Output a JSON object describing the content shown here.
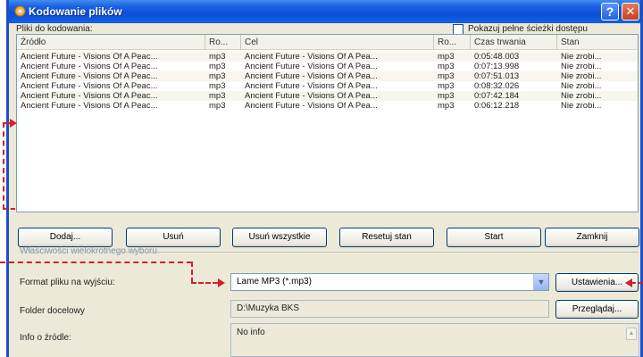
{
  "window": {
    "title": "Kodowanie plików",
    "help_glyph": "?",
    "close_glyph": "✕"
  },
  "files_label": "Pliki do kodowania:",
  "show_full_paths": {
    "label": "Pokazuj pełne ścieżki dostępu",
    "checked": false
  },
  "table": {
    "columns": [
      "Źródło",
      "Ro...",
      "Cel",
      "Ro...",
      "Czas trwania",
      "Stan"
    ],
    "rows": [
      [
        "Ancient Future - Visions Of A Peac...",
        "mp3",
        "Ancient Future - Visions Of A Pea...",
        "mp3",
        "0:05:48.003",
        "Nie zrobi..."
      ],
      [
        "Ancient Future - Visions Of A Peac...",
        "mp3",
        "Ancient Future - Visions Of A Pea...",
        "mp3",
        "0:07:13.998",
        "Nie zrobi..."
      ],
      [
        "Ancient Future - Visions Of A Peac...",
        "mp3",
        "Ancient Future - Visions Of A Pea...",
        "mp3",
        "0:07:51.013",
        "Nie zrobi..."
      ],
      [
        "Ancient Future - Visions Of A Peac...",
        "mp3",
        "Ancient Future - Visions Of A Pea...",
        "mp3",
        "0:08:32.026",
        "Nie zrobi..."
      ],
      [
        "Ancient Future - Visions Of A Peac...",
        "mp3",
        "Ancient Future - Visions Of A Pea...",
        "mp3",
        "0:07:42.184",
        "Nie zrobi..."
      ],
      [
        "Ancient Future - Visions Of A Peac...",
        "mp3",
        "Ancient Future - Visions Of A Pea...",
        "mp3",
        "0:06:12.218",
        "Nie zrobi..."
      ]
    ]
  },
  "buttons": {
    "add": "Dodaj...",
    "remove": "Usuń",
    "remove_all": "Usuń wszystkie",
    "reset": "Resetuj stan",
    "start": "Start",
    "close": "Zamknij"
  },
  "group_title": "Właściwości wielokrotnego wyboru",
  "output_format": {
    "label": "Format pliku na wyjściu:",
    "value": "Lame MP3 (*.mp3)",
    "settings_button": "Ustawienia..."
  },
  "dest_folder": {
    "label": "Folder docelowy",
    "value": "D:\\Muzyka BKS",
    "browse_button": "Przeglądaj..."
  },
  "source_info": {
    "label": "Info o źródle:",
    "value": "No info"
  },
  "icons": {
    "app": "app-icon",
    "dropdown": "chevron-down-icon",
    "scroll_up": "scroll-up-icon"
  },
  "colors": {
    "titlebar": "#0b4fd6",
    "window_bg": "#ece9d8",
    "annotation": "#d0202a"
  }
}
